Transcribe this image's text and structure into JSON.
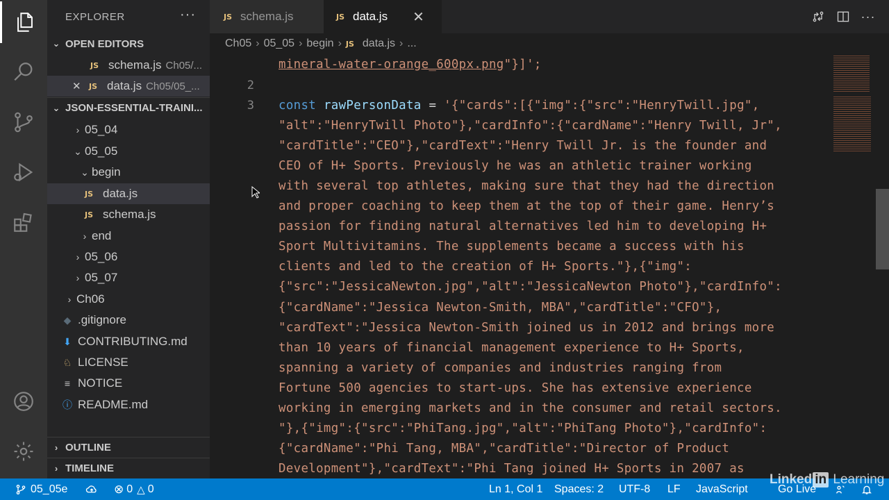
{
  "sidebar": {
    "title": "EXPLORER",
    "more": "···",
    "open_editors": {
      "header": "OPEN EDITORS",
      "items": [
        {
          "icon": "JS",
          "name": "schema.js",
          "path": "Ch05/..."
        },
        {
          "icon": "✕",
          "name": "data.js",
          "path": "Ch05/05_..."
        }
      ]
    },
    "workspace": {
      "header": "JSON-ESSENTIAL-TRAINI...",
      "items": [
        {
          "chev": "›",
          "name": "05_04"
        },
        {
          "chev": "⌄",
          "name": "05_05"
        },
        {
          "chev": "⌄",
          "name": "begin"
        },
        {
          "icon": "JS",
          "name": "data.js"
        },
        {
          "icon": "JS",
          "name": "schema.js"
        },
        {
          "chev": "›",
          "name": "end"
        },
        {
          "chev": "›",
          "name": "05_06"
        },
        {
          "chev": "›",
          "name": "05_07"
        },
        {
          "chev": "›",
          "name": "Ch06"
        },
        {
          "icon": "◆",
          "name": ".gitignore"
        },
        {
          "icon": "⬇",
          "name": "CONTRIBUTING.md"
        },
        {
          "icon": "♘",
          "name": "LICENSE"
        },
        {
          "icon": "≡",
          "name": "NOTICE"
        },
        {
          "icon": "ⓘ",
          "name": "README.md"
        }
      ]
    },
    "outline": "OUTLINE",
    "timeline": "TIMELINE"
  },
  "tabs": [
    {
      "icon": "JS",
      "label": "schema.js",
      "active": false
    },
    {
      "icon": "JS",
      "label": "data.js",
      "active": true,
      "close": "✕"
    }
  ],
  "breadcrumb": [
    "Ch05",
    "05_05",
    "begin",
    "data.js",
    "..."
  ],
  "breadcrumb_file_icon": "JS",
  "editor": {
    "line_numbers": [
      "",
      "2",
      "3"
    ],
    "line0": "mineral-water-orange_600px.png",
    "line0_tail": "\"}]';",
    "line3_kw": "const",
    "line3_var": "rawPersonData",
    "line3_op": "=",
    "code_lines": [
      "'{\"cards\":[{\"img\":{\"src\":\"HenryTwill.jpg\",",
      "\"alt\":\"HenryTwill Photo\"},\"cardInfo\":{\"cardName\":\"Henry Twill, Jr\",",
      "\"cardTitle\":\"CEO\"},\"cardText\":\"Henry Twill Jr. is the founder and",
      "CEO of H+ Sports. Previously he was an athletic trainer working",
      "with several top athletes, making sure that they had the direction",
      "and proper coaching to keep them at the top of their game. Henry’s",
      "passion for finding natural alternatives led him to developing H+",
      "Sport Multivitamins. The supplements became a success with his",
      "clients and led to the creation of H+ Sports.\"},{\"img\":",
      "{\"src\":\"JessicaNewton.jpg\",\"alt\":\"JessicaNewton Photo\"},\"cardInfo\":",
      "{\"cardName\":\"Jessica Newton-Smith, MBA\",\"cardTitle\":\"CFO\"},",
      "\"cardText\":\"Jessica Newton-Smith joined us in 2012 and brings more",
      "than 10 years of financial management experience to H+ Sports,",
      "spanning a variety of companies and industries ranging from",
      "Fortune 500 agencies to start-ups. She has extensive experience",
      "working in emerging markets and in the consumer and retail sectors.",
      "\"},{\"img\":{\"src\":\"PhiTang.jpg\",\"alt\":\"PhiTang Photo\"},\"cardInfo\":",
      "{\"cardName\":\"Phi Tang, MBA\",\"cardTitle\":\"Director of Product",
      "Development\"},\"cardText\":\"Phi Tang joined H+ Sports in 2007 as"
    ]
  },
  "status": {
    "branch": "05_05e",
    "errors": "0",
    "warnings": "0",
    "position": "Ln 1, Col 1",
    "spaces": "Spaces: 2",
    "encoding": "UTF-8",
    "eol": "LF",
    "language": "JavaScript",
    "golive": "Go Live"
  },
  "watermark": {
    "a": "Linked",
    "b": "in",
    "c": "Learning"
  }
}
